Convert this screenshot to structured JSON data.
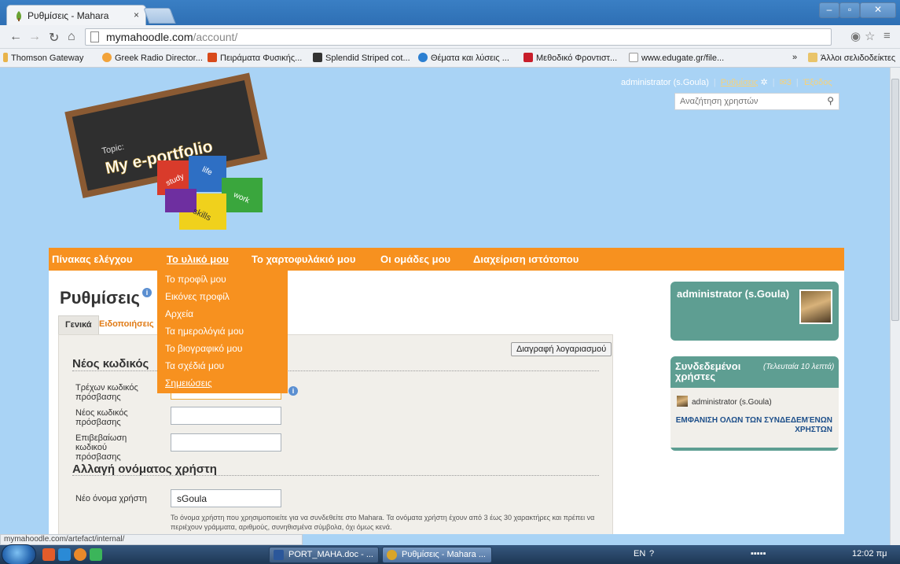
{
  "browser": {
    "tab_title": "Ρυθμίσεις - Mahara",
    "tab_close": "×",
    "url_host": "mymahoodle.com",
    "url_path": "/account/",
    "bookmarks": [
      {
        "label": "Thomson Gateway",
        "color": "#e8b34a"
      },
      {
        "label": "Greek Radio Director...",
        "color": "#f2a33a"
      },
      {
        "label": "Πειράματα Φυσικής...",
        "color": "#d84a1b"
      },
      {
        "label": "Splendid Striped cot...",
        "color": "#333333"
      },
      {
        "label": "Θέματα και λύσεις ...",
        "color": "#2c7fd1"
      },
      {
        "label": "Μεθοδικό Φροντιστ...",
        "color": "#c81e2b"
      },
      {
        "label": "www.edugate.gr/file...",
        "color": "#ffffff"
      }
    ],
    "bookmarks_more": "»",
    "other_bookmarks": "Άλλοι σελιδοδείκτες",
    "status_url": "mymahoodle.com/artefact/internal/"
  },
  "header": {
    "user_link": "administrator (s.Goula)",
    "settings_link": "Ρυθμίσεις",
    "inbox_count": "3",
    "logout_link": "Έξοδος",
    "search_placeholder": "Αναζήτηση χρηστών"
  },
  "logo": {
    "topic": "Topic:",
    "title": "My e-portfolio",
    "pieces": [
      "study",
      "life",
      "work",
      "skills"
    ]
  },
  "nav": {
    "items": [
      "Πίνακας ελέγχου",
      "Το υλικό μου",
      "Το χαρτοφυλάκιό μου",
      "Οι ομάδες μου",
      "Διαχείριση ιστότοπου"
    ],
    "active_index": 1
  },
  "dropdown": {
    "items": [
      "Το προφίλ μου",
      "Εικόνες προφίλ",
      "Αρχεία",
      "Τα ημερολόγιά μου",
      "Το βιογραφικό μου",
      "Τα σχέδιά μου",
      "Σημειώσεις"
    ]
  },
  "main": {
    "title": "Ρυθμίσεις",
    "info": "i",
    "tabs": [
      "Γενικά",
      "Ειδοποιήσεις"
    ],
    "delete_account": "Διαγραφή λογαριασμού",
    "password_section": "Νέος κωδικός",
    "current_password_label": "Τρέχων κωδικός πρόσβασης",
    "new_password_label": "Νέος κωδικός πρόσβασης",
    "confirm_password_label": "Επιβεβαίωση κωδικού πρόσβασης",
    "username_section": "Αλλαγή ονόματος χρήστη",
    "new_username_label": "Νέο όνομα χρήστη",
    "new_username_value": "sGoula",
    "username_help": "Το όνομα χρήστη που χρησιμοποιείτε για να συνδεθείτε στο Mahara. Τα ονόματα χρήστη έχουν από 3 έως 30 χαρακτήρες και πρέπει να περιέχουν γράμματα, αριθμούς, συνηθισμένα σύμβολα, όχι όμως κενά."
  },
  "sidebar": {
    "profile_name": "administrator (s.Goula)",
    "online_title": "Συνδεδεμένοι χρήστες",
    "online_subtitle": "(Τελευταία 10 λεπτά)",
    "online_user": "administrator (s.Goula)",
    "show_all": "ΕΜΦΑΝΙΣΗ ΟΛΩΝ ΤΩΝ ΣΥΝΔΕΔΕΜΈΝΩΝ ΧΡΗΣΤΩΝ"
  },
  "taskbar": {
    "tasks": [
      "PORT_MAHA.doc - ...",
      "Ρυθμίσεις - Mahara ..."
    ],
    "lang": "EN",
    "clock": "12:02 πμ"
  },
  "colors": {
    "accent_orange": "#f7911f",
    "teal": "#5e9e92",
    "page_bg": "#a9d3f5"
  }
}
